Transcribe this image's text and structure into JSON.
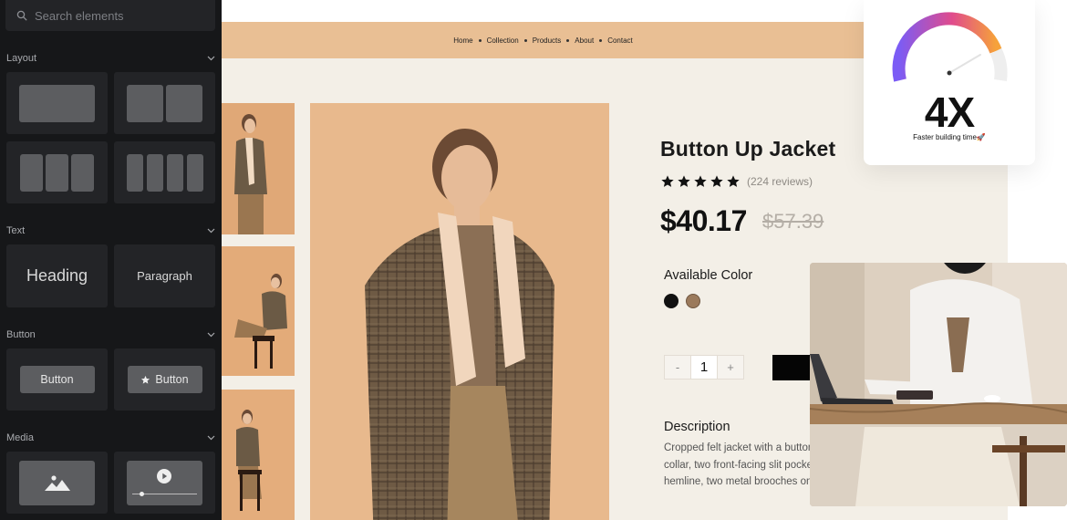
{
  "sidebar": {
    "search_placeholder": "Search elements",
    "sections": {
      "layout": "Layout",
      "text": "Text",
      "button": "Button",
      "media": "Media"
    },
    "text_tiles": {
      "heading": "Heading",
      "paragraph": "Paragraph"
    },
    "button_tiles": {
      "plain": "Button",
      "icon": "Button"
    }
  },
  "nav": [
    "Home",
    "Collection",
    "Products",
    "About",
    "Contact"
  ],
  "product": {
    "title": "Button Up Jacket",
    "rating": 5,
    "reviews": "(224 reviews)",
    "price": "$40.17",
    "old_price": "$57.39",
    "available_color_label": "Available Color",
    "colors": [
      "#111111",
      "#9b7a5c"
    ],
    "quantity": "1",
    "minus": "-",
    "plus": "+",
    "description_title": "Description",
    "description_lines": [
      "Cropped felt jacket with a button",
      "collar, two front-facing slit pocke",
      "hemline, two metal brooches on"
    ]
  },
  "stat": {
    "value": "4X",
    "label": "Faster building time🚀"
  },
  "colors": {
    "panel_bg": "#161719",
    "tile_bg": "#232427",
    "nav_bg": "#e9bf94",
    "page_bg": "#f3efe7",
    "gauge_start": "#7b5cf5",
    "gauge_mid": "#e04b8c",
    "gauge_end": "#f6a23a"
  }
}
